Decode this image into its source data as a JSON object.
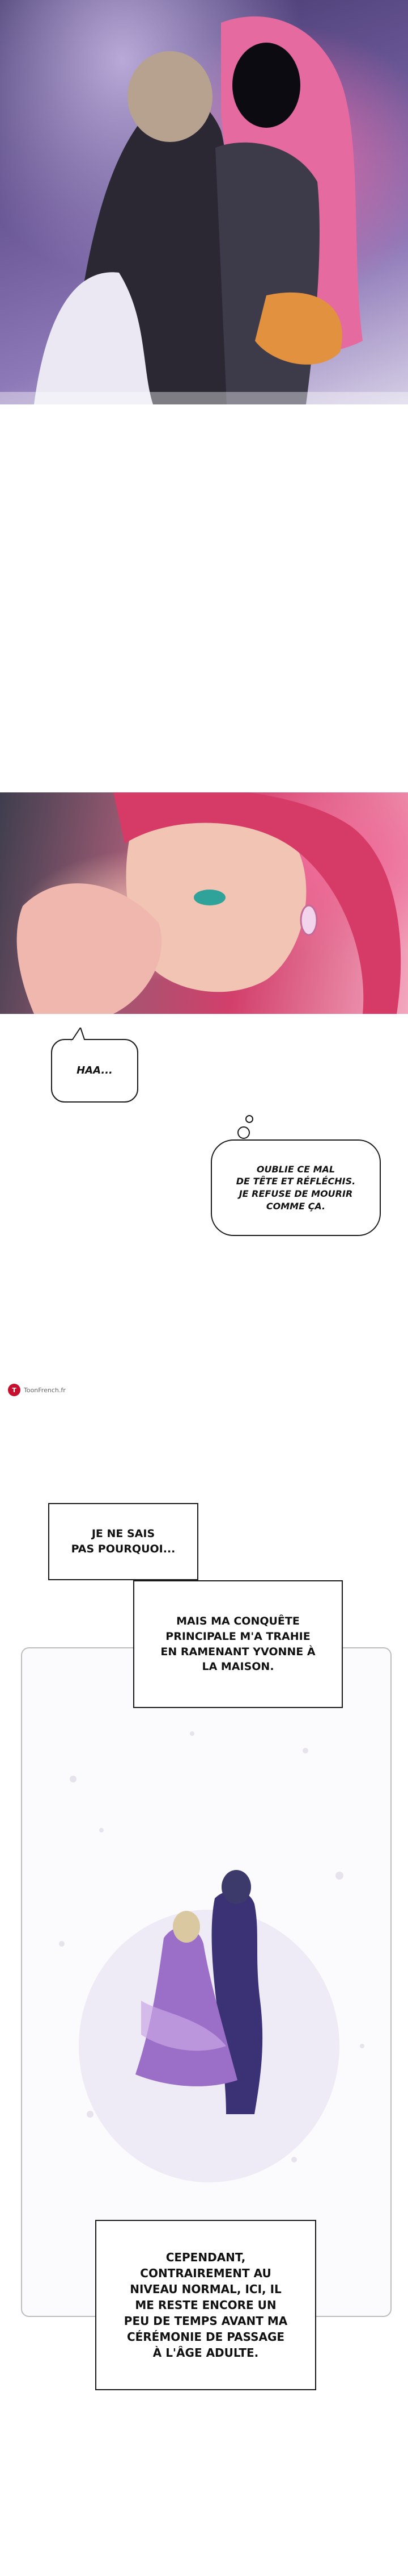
{
  "bubbles": {
    "haa": "HAA...",
    "thought": "OUBLIE CE MAL\nDE TÊTE ET RÉFLÉCHIS.\nJE REFUSE DE MOURIR\nCOMME ÇA."
  },
  "narration": {
    "box1": "JE NE SAIS\nPAS POURQUOI...",
    "box2": "MAIS MA CONQUÊTE\nPRINCIPALE M'A TRAHIE\nEN RAMENANT YVONNE À\nLA MAISON.",
    "box3": "CEPENDANT,\nCONTRAIREMENT AU\nNIVEAU NORMAL, ICI, IL\nME RESTE ENCORE UN\nPEU DE TEMPS AVANT MA\nCÉRÉMONIE DE PASSAGE\nÀ L'ÂGE ADULTE."
  },
  "watermark": {
    "logo_letter": "T",
    "text": "ToonFrench.fr"
  },
  "colors": {
    "panel_border": "#bdbdbd",
    "ink": "#111111",
    "watermark_red": "#c8102e"
  }
}
